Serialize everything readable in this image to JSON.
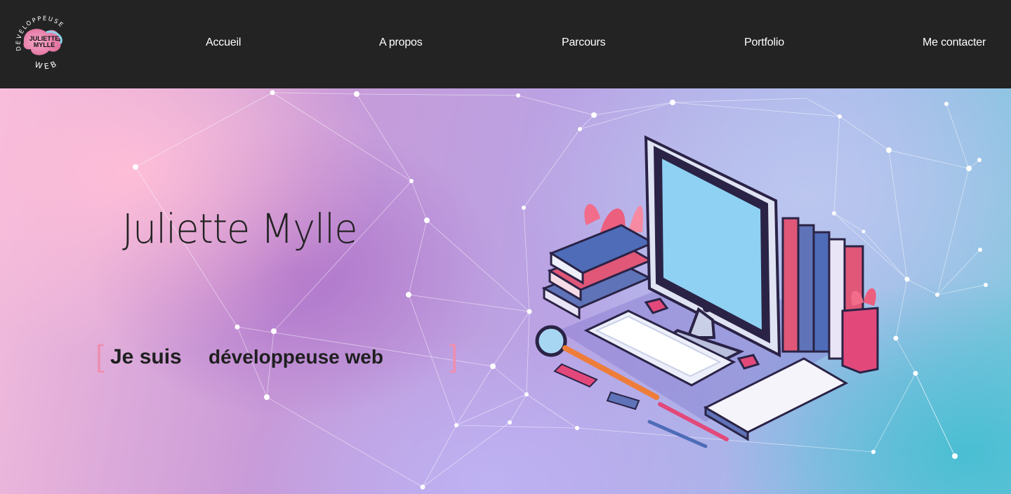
{
  "header": {
    "logo": {
      "ring_text_top": "DEVELOPPEUSE",
      "ring_text_bottom": "WEB",
      "center_line1": "JULIETTE",
      "center_line2": "MYLLE"
    },
    "nav": [
      {
        "label": "Accueil"
      },
      {
        "label": "A propos"
      },
      {
        "label": "Parcours"
      },
      {
        "label": "Portfolio"
      },
      {
        "label": "Me contacter"
      }
    ]
  },
  "hero": {
    "name": "Juliette Mylle",
    "tagline_prefix": "Je suis",
    "tagline_rotating": "développeuse web",
    "bracket_open": "[",
    "bracket_close": "]"
  },
  "colors": {
    "header_bg": "#232323",
    "bracket_accent": "#ee8fb0",
    "text_dark": "#1f1f1f"
  }
}
